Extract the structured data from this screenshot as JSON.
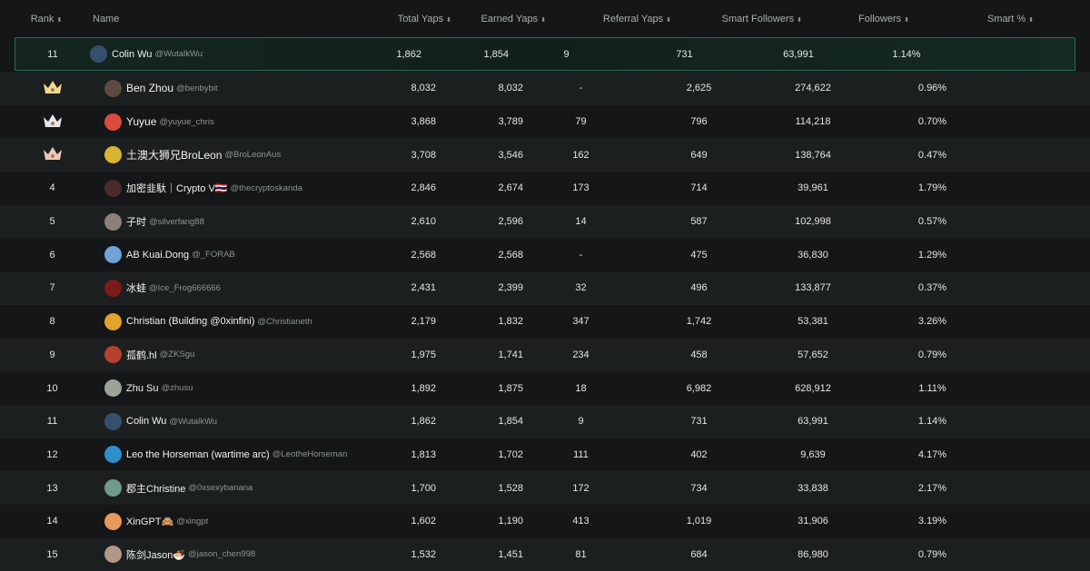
{
  "columns": {
    "rank": "Rank",
    "name": "Name",
    "total": "Total Yaps",
    "earned": "Earned Yaps",
    "referral": "Referral Yaps",
    "smart": "Smart Followers",
    "followers": "Followers",
    "pct": "Smart %",
    "sort_glyph": "⬍"
  },
  "colors": {
    "accent_border": "#2d6a56",
    "crown_gold": "#f5d98b",
    "crown_silver": "#e6e6e6",
    "crown_bronze": "#f0c6b8"
  },
  "pinned": {
    "rank": "11",
    "name": "Colin Wu",
    "handle": "@WutalkWu",
    "total": "1,862",
    "earned": "1,854",
    "referral": "9",
    "smart": "731",
    "followers": "63,991",
    "pct": "1.14%",
    "avatar": "#35506f"
  },
  "rows": [
    {
      "rank": "",
      "crown": "gold",
      "name": "Ben Zhou",
      "handle": "@benbybit",
      "total": "8,032",
      "earned": "8,032",
      "referral": "-",
      "smart": "2,625",
      "followers": "274,622",
      "pct": "0.96%",
      "avatar": "#5a4a40",
      "big": true
    },
    {
      "rank": "",
      "crown": "silver",
      "name": "Yuyue",
      "handle": "@yuyue_chris",
      "total": "3,868",
      "earned": "3,789",
      "referral": "79",
      "smart": "796",
      "followers": "114,218",
      "pct": "0.70%",
      "avatar": "#d94b3a",
      "big": true
    },
    {
      "rank": "",
      "crown": "bronze",
      "name": "土澳大狮兄BroLeon",
      "handle": "@BroLeonAus",
      "total": "3,708",
      "earned": "3,546",
      "referral": "162",
      "smart": "649",
      "followers": "138,764",
      "pct": "0.47%",
      "avatar": "#d8b531",
      "big": true
    },
    {
      "rank": "4",
      "name": "加密韭馱｜Crypto V🇹🇭",
      "handle": "@thecryptoskanda",
      "total": "2,846",
      "earned": "2,674",
      "referral": "173",
      "smart": "714",
      "followers": "39,961",
      "pct": "1.79%",
      "avatar": "#4a2a2a"
    },
    {
      "rank": "5",
      "name": "子时",
      "handle": "@silverfang88",
      "total": "2,610",
      "earned": "2,596",
      "referral": "14",
      "smart": "587",
      "followers": "102,998",
      "pct": "0.57%",
      "avatar": "#8c7f7a"
    },
    {
      "rank": "6",
      "name": "AB Kuai.Dong",
      "handle": "@_FORAB",
      "total": "2,568",
      "earned": "2,568",
      "referral": "-",
      "smart": "475",
      "followers": "36,830",
      "pct": "1.29%",
      "avatar": "#6fa3d8"
    },
    {
      "rank": "7",
      "name": "冰蛙",
      "handle": "@Ice_Frog666666",
      "total": "2,431",
      "earned": "2,399",
      "referral": "32",
      "smart": "496",
      "followers": "133,877",
      "pct": "0.37%",
      "avatar": "#7a1a1a"
    },
    {
      "rank": "8",
      "name": "Christian (Building @0xinfini)",
      "handle": "@Christianeth",
      "total": "2,179",
      "earned": "1,832",
      "referral": "347",
      "smart": "1,742",
      "followers": "53,381",
      "pct": "3.26%",
      "avatar": "#e3a32b"
    },
    {
      "rank": "9",
      "name": "孤鹤.hl",
      "handle": "@ZKSgu",
      "total": "1,975",
      "earned": "1,741",
      "referral": "234",
      "smart": "458",
      "followers": "57,652",
      "pct": "0.79%",
      "avatar": "#b2432f"
    },
    {
      "rank": "10",
      "name": "Zhu Su",
      "handle": "@zhusu",
      "total": "1,892",
      "earned": "1,875",
      "referral": "18",
      "smart": "6,982",
      "followers": "628,912",
      "pct": "1.11%",
      "avatar": "#9aa39a"
    },
    {
      "rank": "11",
      "name": "Colin Wu",
      "handle": "@WutalkWu",
      "total": "1,862",
      "earned": "1,854",
      "referral": "9",
      "smart": "731",
      "followers": "63,991",
      "pct": "1.14%",
      "avatar": "#35506f"
    },
    {
      "rank": "12",
      "name": "Leo the Horseman (wartime arc)",
      "handle": "@LeotheHorseman",
      "total": "1,813",
      "earned": "1,702",
      "referral": "111",
      "smart": "402",
      "followers": "9,639",
      "pct": "4.17%",
      "avatar": "#2f8fc9"
    },
    {
      "rank": "13",
      "name": "郡主Christine",
      "handle": "@0xsexybanana",
      "total": "1,700",
      "earned": "1,528",
      "referral": "172",
      "smart": "734",
      "followers": "33,838",
      "pct": "2.17%",
      "avatar": "#6f9a8a"
    },
    {
      "rank": "14",
      "name": "XinGPT🙈",
      "handle": "@xingpt",
      "total": "1,602",
      "earned": "1,190",
      "referral": "413",
      "smart": "1,019",
      "followers": "31,906",
      "pct": "3.19%",
      "avatar": "#e79a5a"
    },
    {
      "rank": "15",
      "name": "陈剑Jason🍜",
      "handle": "@jason_chen998",
      "total": "1,532",
      "earned": "1,451",
      "referral": "81",
      "smart": "684",
      "followers": "86,980",
      "pct": "0.79%",
      "avatar": "#b09888"
    }
  ]
}
